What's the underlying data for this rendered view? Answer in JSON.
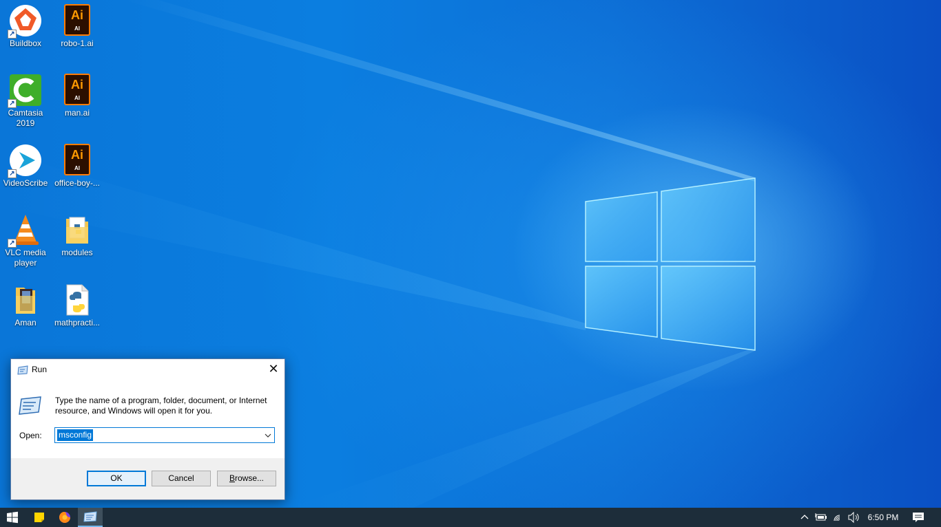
{
  "desktop": {
    "icons": [
      {
        "label": "Buildbox",
        "icon": "buildbox-icon"
      },
      {
        "label": "robo-1.ai",
        "icon": "illustrator-file-icon"
      },
      {
        "label": "Camtasia 2019",
        "icon": "camtasia-icon"
      },
      {
        "label": "man.ai",
        "icon": "illustrator-file-icon"
      },
      {
        "label": "VideoScribe",
        "icon": "videoscribe-icon"
      },
      {
        "label": "office-boy-...",
        "icon": "illustrator-file-icon"
      },
      {
        "label": "VLC media player",
        "icon": "vlc-icon"
      },
      {
        "label": "modules",
        "icon": "python-folder-icon"
      },
      {
        "label": "Aman",
        "icon": "folder-icon"
      },
      {
        "label": "mathpracti...",
        "icon": "python-file-icon"
      }
    ],
    "ai_badge": {
      "big": "Ai",
      "small": "AI"
    }
  },
  "run_dialog": {
    "title": "Run",
    "close_glyph": "✕",
    "description": "Type the name of a program, folder, document, or Internet resource, and Windows will open it for you.",
    "open_label": "Open:",
    "open_value": "msconfig",
    "ok_label": "OK",
    "cancel_label": "Cancel",
    "browse_label_underlined": "B",
    "browse_label_rest": "rowse..."
  },
  "taskbar": {
    "items": [
      "start-icon",
      "sticky-notes-icon",
      "firefox-icon",
      "run-app-icon"
    ],
    "tray_icons": [
      "chevron-up-icon",
      "battery-icon",
      "wifi-icon",
      "volume-icon"
    ],
    "clock": "6:50 PM"
  },
  "colors": {
    "accent": "#0078d7",
    "taskbar": "#1d2d3a"
  }
}
